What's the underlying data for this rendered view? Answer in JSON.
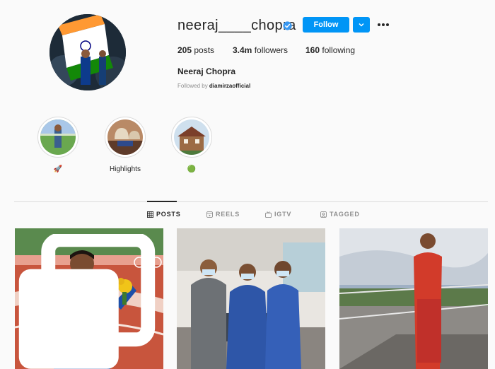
{
  "profile": {
    "username": "neeraj____chopra",
    "verified": true,
    "follow_label": "Follow",
    "posts_count": "205",
    "posts_label": "posts",
    "followers_count": "3.4m",
    "followers_label": "followers",
    "following_count": "160",
    "following_label": "following",
    "full_name": "Neeraj Chopra",
    "followed_by_prefix": "Followed by",
    "followed_by_account": "diamirzaofficial"
  },
  "highlights": [
    {
      "label": "🚀"
    },
    {
      "label": "Highlights"
    },
    {
      "label": "🟢"
    }
  ],
  "tabs": [
    {
      "label": "POSTS",
      "active": true,
      "icon": "grid-icon"
    },
    {
      "label": "REELS",
      "active": false,
      "icon": "reels-icon"
    },
    {
      "label": "IGTV",
      "active": false,
      "icon": "igtv-icon"
    },
    {
      "label": "TAGGED",
      "active": false,
      "icon": "tagged-icon"
    }
  ],
  "posts": [
    {
      "type": "carousel"
    },
    {
      "type": "image"
    },
    {
      "type": "image"
    }
  ],
  "colors": {
    "accent": "#0095f6",
    "text": "#262626",
    "muted": "#8e8e8e",
    "border": "#dbdbdb",
    "background": "#fafafa"
  }
}
